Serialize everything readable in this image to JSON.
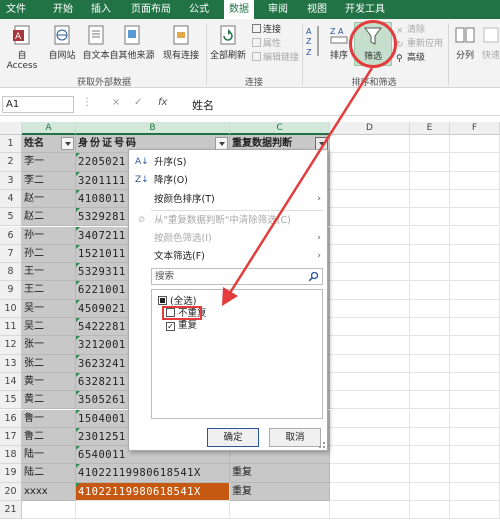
{
  "ribbon": {
    "file_tab": "文件",
    "tabs": [
      "开始",
      "插入",
      "页面布局",
      "公式",
      "数据",
      "审阅",
      "视图",
      "开发工具"
    ],
    "active_tab": "数据",
    "get_external": {
      "buttons": [
        "自 Access",
        "自网站",
        "自文本",
        "自其他来源",
        "现有连接"
      ],
      "label": "获取外部数据"
    },
    "connections": {
      "refresh": "全部刷新",
      "items": [
        "连接",
        "属性",
        "编辑链接"
      ],
      "label": "连接"
    },
    "sort_filter": {
      "sort_button": "排序",
      "filter_button": "筛选",
      "items": [
        "清除",
        "重新应用",
        "高级"
      ],
      "label": "排序和筛选"
    },
    "data_tools": {
      "split_button": "分列",
      "quick_fill": "快速"
    }
  },
  "formula_bar": {
    "name_box": "A1",
    "fx_label": "fx",
    "cancel_symbol": "×",
    "enter_symbol": "✓",
    "more_symbol": "⋮",
    "value": "姓名"
  },
  "grid": {
    "col_headers": [
      "A",
      "B",
      "C",
      "D",
      "E",
      "F"
    ],
    "row_numbers": [
      "1",
      "2",
      "3",
      "4",
      "5",
      "6",
      "7",
      "8",
      "9",
      "10",
      "11",
      "12",
      "13",
      "14",
      "15",
      "16",
      "17",
      "18",
      "19",
      "20",
      "21"
    ],
    "header": {
      "name": "姓名",
      "id": "身份证号码",
      "dup": "重复数据判断"
    },
    "names": [
      "李一",
      "李二",
      "赵一",
      "赵二",
      "孙一",
      "孙二",
      "王一",
      "王二",
      "吴一",
      "吴二",
      "张一",
      "张二",
      "黄一",
      "黄二",
      "鲁一",
      "鲁二",
      "陆一",
      "陆二",
      "xxxx"
    ],
    "ids_partial": [
      "2205021",
      "3201111",
      "4108011",
      "5329281",
      "3407211",
      "1521011",
      "5329311",
      "6221001",
      "4509021",
      "5422281",
      "3212001",
      "3623241",
      "6328211",
      "3505261",
      "1504001",
      "2301251",
      "6540011"
    ],
    "row19_id": "41022119980618541X",
    "row19_dup": "重复",
    "row20_id": "41022119980618541X",
    "row20_dup": "重复"
  },
  "filter_menu": {
    "items": [
      {
        "label": "升序(S)",
        "icon": "sort-asc-icon"
      },
      {
        "label": "降序(O)",
        "icon": "sort-desc-icon"
      },
      {
        "label": "按颜色排序(T)",
        "icon": ""
      },
      {
        "label": "从\"重复数据判断\"中清除筛选(C)",
        "icon": "clear-filter-icon"
      },
      {
        "label": "按颜色筛选(I)",
        "icon": ""
      },
      {
        "label": "文本筛选(F)",
        "icon": ""
      }
    ],
    "search_placeholder": "搜索",
    "checklist": [
      {
        "label": "(全选)",
        "state": "partial"
      },
      {
        "label": "不重复",
        "state": "unchecked"
      },
      {
        "label": "重复",
        "state": "checked"
      }
    ],
    "ok": "确定",
    "cancel": "取消"
  },
  "colors": {
    "excel_green": "#217346",
    "selection_gray": "#c8c8c8",
    "highlight_orange": "#c65911",
    "annotation_red": "#e23c3c"
  }
}
